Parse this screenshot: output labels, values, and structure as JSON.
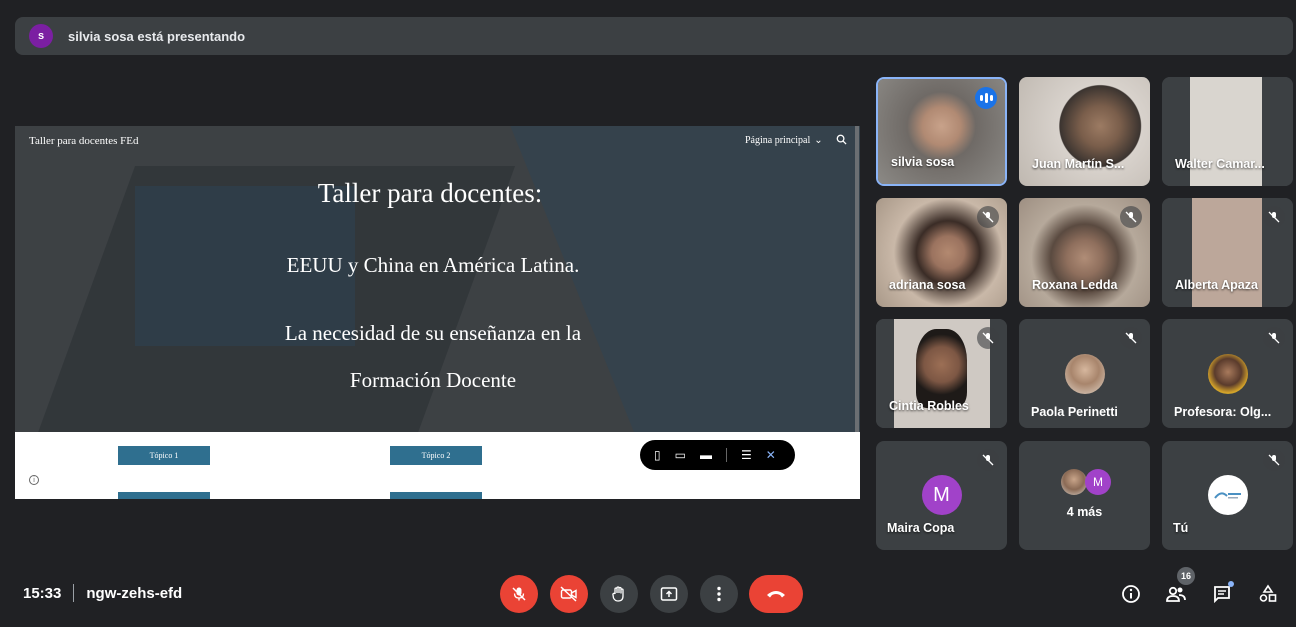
{
  "presenting": {
    "avatar_letter": "s",
    "text": "silvia sosa está presentando"
  },
  "shared_page": {
    "site_title": "Taller para docentes FEd",
    "nav_label": "Página principal",
    "heading": "Taller para docentes:",
    "line2": "EEUU y China en América Latina.",
    "line3": "La necesidad de su enseñanza en la",
    "line4": "Formación Docente",
    "topic1": "Tópico 1",
    "topic2": "Tópico 2"
  },
  "participants": [
    {
      "name": "silvia sosa",
      "speaking": true
    },
    {
      "name": "Juan Martín S..."
    },
    {
      "name": "Walter Camar..."
    },
    {
      "name": "adriana sosa",
      "muted": true
    },
    {
      "name": "Roxana Ledda",
      "muted": true
    },
    {
      "name": "Alberta Apaza",
      "muted": true
    },
    {
      "name": "Cintia Robles",
      "muted": true
    },
    {
      "name": "Paola Perinetti",
      "muted": true
    },
    {
      "name": "Profesora: Olg...",
      "muted": true
    },
    {
      "name": "Maira Copa",
      "avatar_letter": "M",
      "avatar_color": "#a142c9",
      "muted": true
    },
    {
      "name": "4 más",
      "avatar_letter": "M"
    },
    {
      "name": "Tú",
      "muted": true
    }
  ],
  "bottom_bar": {
    "time": "15:33",
    "meeting_code": "ngw-zehs-efd",
    "participants_count": "16"
  },
  "colors": {
    "danger": "#ea4335",
    "active_border": "#8ab4f8",
    "speaking": "#1a73e8"
  }
}
